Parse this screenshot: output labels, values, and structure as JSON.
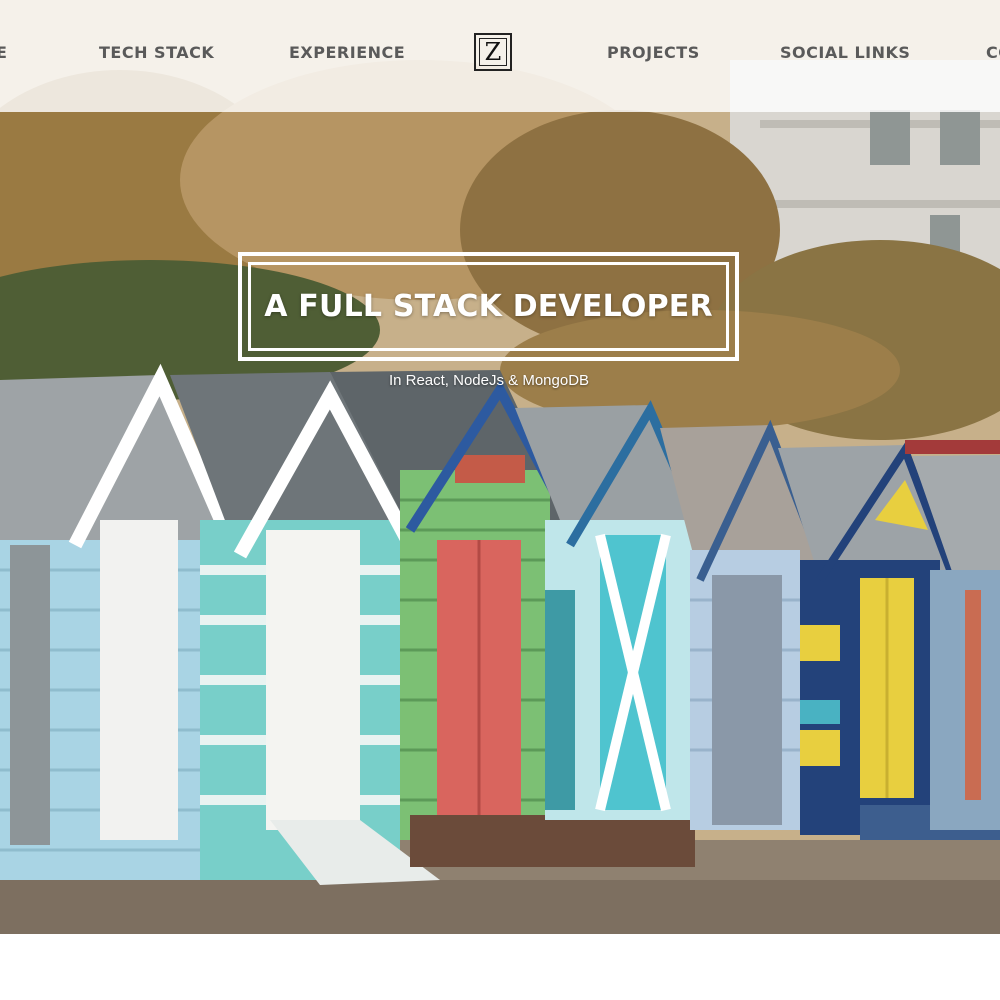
{
  "nav": {
    "items": [
      {
        "label": "E"
      },
      {
        "label": "TECH STACK"
      },
      {
        "label": "EXPERIENCE"
      },
      {
        "label": "PROJECTS"
      },
      {
        "label": "SOCIAL LINKS"
      },
      {
        "label": "CO"
      }
    ],
    "logo_letter": "Z"
  },
  "hero": {
    "title": "A FULL STACK DEVELOPER",
    "subtitle": "In React, NodeJs & MongoDB",
    "image_semantic": "beach-huts-photo"
  },
  "colors": {
    "nav_text": "#5a5a5a",
    "title_text": "#ffffff",
    "hut_red": "#d9655e",
    "hut_green": "#7fbf6a",
    "hut_teal": "#4fc4cf",
    "hut_yellow": "#e8cf3f"
  }
}
